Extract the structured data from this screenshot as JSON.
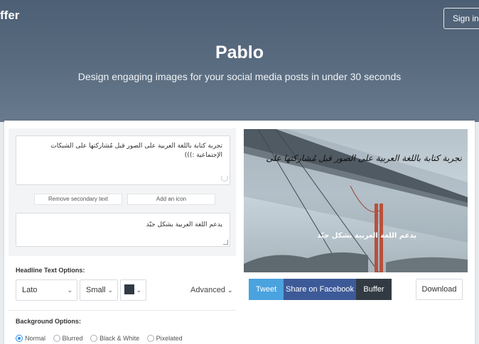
{
  "header": {
    "logo": "ffer",
    "signin_label": "Sign in or",
    "title": "Pablo",
    "subtitle": "Design engaging images for your social media posts in under 30 seconds"
  },
  "editor": {
    "headline_lines": [
      "تجربة كتابة باللغة العربية على الصور قبل مُشاركتها على الشبكات",
      "الإجتماعية :)))"
    ],
    "remove_secondary_label": "Remove secondary text",
    "add_icon_label": "Add an icon",
    "secondary_text": "يدعم اللغة العربية بشكل جيّد",
    "headline_options_label": "Headline Text Options:",
    "font_value": "Lato",
    "size_value": "Small",
    "text_color": "#2f3a45",
    "advanced_label": "Advanced",
    "background_options_label": "Background Options:",
    "background_options": [
      {
        "label": "Normal",
        "selected": true
      },
      {
        "label": "Blurred",
        "selected": false
      },
      {
        "label": "Black & White",
        "selected": false
      },
      {
        "label": "Pixelated",
        "selected": false
      }
    ]
  },
  "preview": {
    "headline_text": "تجربة كتابة باللغة العربية على الصور قبل مُشاركتها على",
    "secondary_text": "يدعم اللغة العربية بشكل جيّد"
  },
  "actions": {
    "tweet_label": "Tweet",
    "facebook_label": "Share on Facebook",
    "buffer_label": "Buffer",
    "download_label": "Download"
  },
  "colors": {
    "tweet": "#4aa3df",
    "facebook": "#3d5a98",
    "buffer": "#323b43",
    "radio_selected": "#2d8cf0"
  }
}
